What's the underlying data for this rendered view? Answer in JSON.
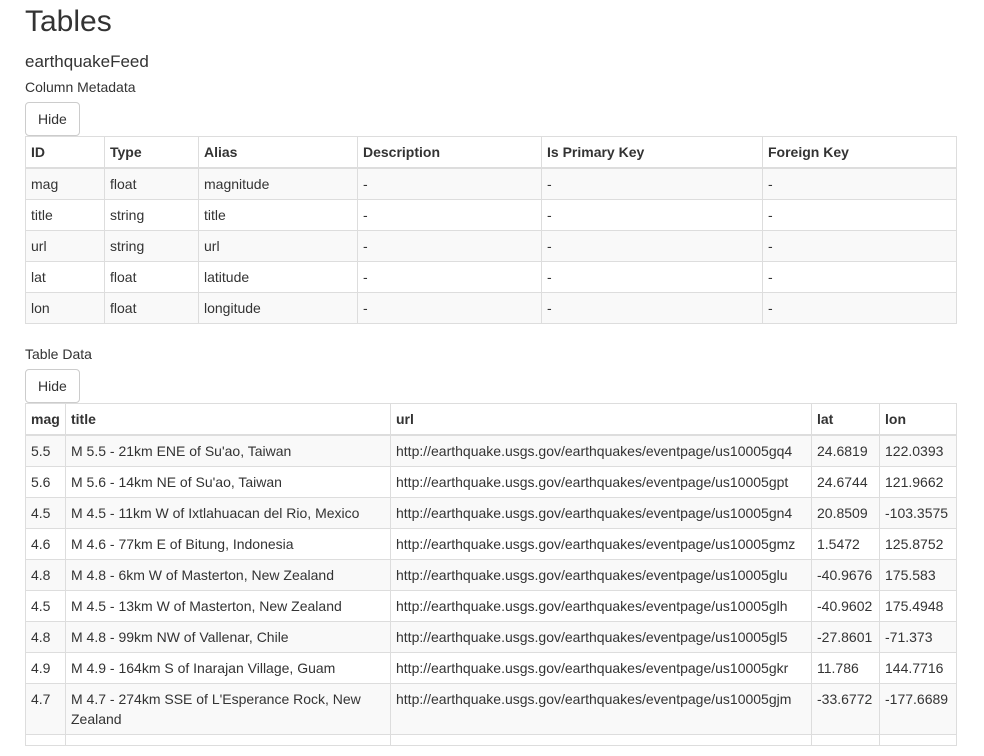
{
  "page": {
    "title": "Tables",
    "table_name": "earthquakeFeed"
  },
  "column_metadata": {
    "caption": "Column Metadata",
    "hide_label": "Hide",
    "headers": [
      "ID",
      "Type",
      "Alias",
      "Description",
      "Is Primary Key",
      "Foreign Key"
    ],
    "rows": [
      [
        "mag",
        "float",
        "magnitude",
        "-",
        "-",
        "-"
      ],
      [
        "title",
        "string",
        "title",
        "-",
        "-",
        "-"
      ],
      [
        "url",
        "string",
        "url",
        "-",
        "-",
        "-"
      ],
      [
        "lat",
        "float",
        "latitude",
        "-",
        "-",
        "-"
      ],
      [
        "lon",
        "float",
        "longitude",
        "-",
        "-",
        "-"
      ]
    ]
  },
  "table_data": {
    "caption": "Table Data",
    "hide_label": "Hide",
    "headers": [
      "mag",
      "title",
      "url",
      "lat",
      "lon"
    ],
    "rows": [
      [
        "5.5",
        "M 5.5 - 21km ENE of Su'ao, Taiwan",
        "http://earthquake.usgs.gov/earthquakes/eventpage/us10005gq4",
        "24.6819",
        "122.0393"
      ],
      [
        "5.6",
        "M 5.6 - 14km NE of Su'ao, Taiwan",
        "http://earthquake.usgs.gov/earthquakes/eventpage/us10005gpt",
        "24.6744",
        "121.9662"
      ],
      [
        "4.5",
        "M 4.5 - 11km W of Ixtlahuacan del Rio, Mexico",
        "http://earthquake.usgs.gov/earthquakes/eventpage/us10005gn4",
        "20.8509",
        "-103.3575"
      ],
      [
        "4.6",
        "M 4.6 - 77km E of Bitung, Indonesia",
        "http://earthquake.usgs.gov/earthquakes/eventpage/us10005gmz",
        "1.5472",
        "125.8752"
      ],
      [
        "4.8",
        "M 4.8 - 6km W of Masterton, New Zealand",
        "http://earthquake.usgs.gov/earthquakes/eventpage/us10005glu",
        "-40.9676",
        "175.583"
      ],
      [
        "4.5",
        "M 4.5 - 13km W of Masterton, New Zealand",
        "http://earthquake.usgs.gov/earthquakes/eventpage/us10005glh",
        "-40.9602",
        "175.4948"
      ],
      [
        "4.8",
        "M 4.8 - 99km NW of Vallenar, Chile",
        "http://earthquake.usgs.gov/earthquakes/eventpage/us10005gl5",
        "-27.8601",
        "-71.373"
      ],
      [
        "4.9",
        "M 4.9 - 164km S of Inarajan Village, Guam",
        "http://earthquake.usgs.gov/earthquakes/eventpage/us10005gkr",
        "11.786",
        "144.7716"
      ],
      [
        "4.7",
        "M 4.7 - 274km SSE of L'Esperance Rock, New Zealand",
        "http://earthquake.usgs.gov/earthquakes/eventpage/us10005gjm",
        "-33.6772",
        "-177.6689"
      ],
      [
        "",
        "",
        "",
        "",
        ""
      ]
    ]
  }
}
